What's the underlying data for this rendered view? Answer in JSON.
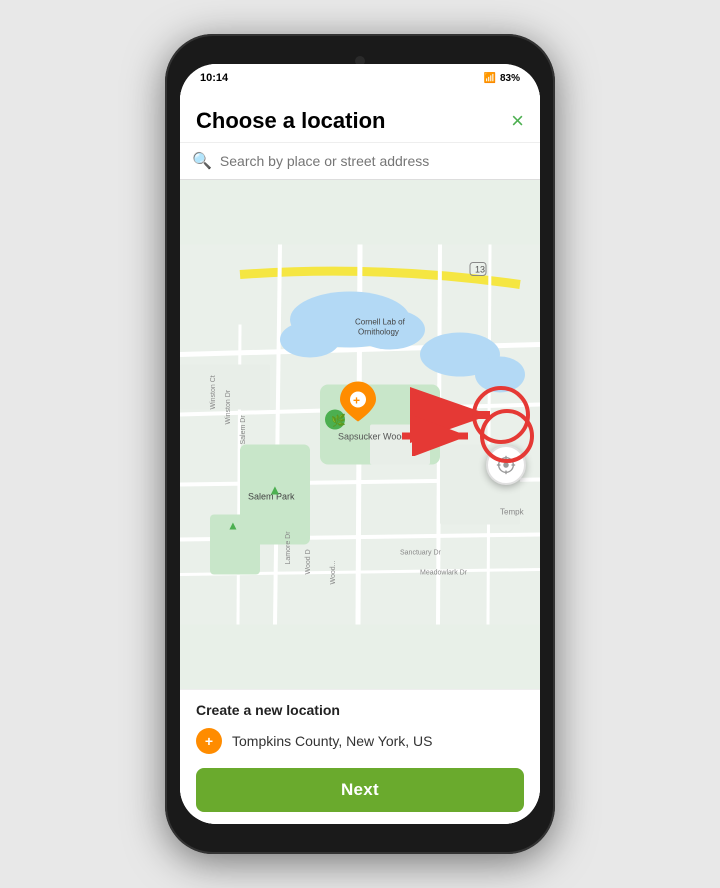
{
  "status_bar": {
    "time": "10:14",
    "battery": "83%"
  },
  "dialog": {
    "title": "Choose a location",
    "close_label": "×"
  },
  "search": {
    "placeholder": "Search by place or street address"
  },
  "map": {
    "label_cornell": "Cornell Lab of Ornithology",
    "label_sapsucker": "Sapsucker Woods",
    "label_salem_park": "Salem Park",
    "label_route": "13"
  },
  "gps_button": {
    "icon": "⊕"
  },
  "bottom_panel": {
    "section_title": "Create a new location",
    "location_text": "Tompkins County, New York, US",
    "next_button_label": "Next"
  },
  "colors": {
    "accent_green": "#6aaa2d",
    "close_green": "#4CAF50",
    "water_blue": "#b3d9f5",
    "park_green": "#c8e6c9",
    "pin_orange": "#FF8C00",
    "red_annotation": "#e53935"
  }
}
